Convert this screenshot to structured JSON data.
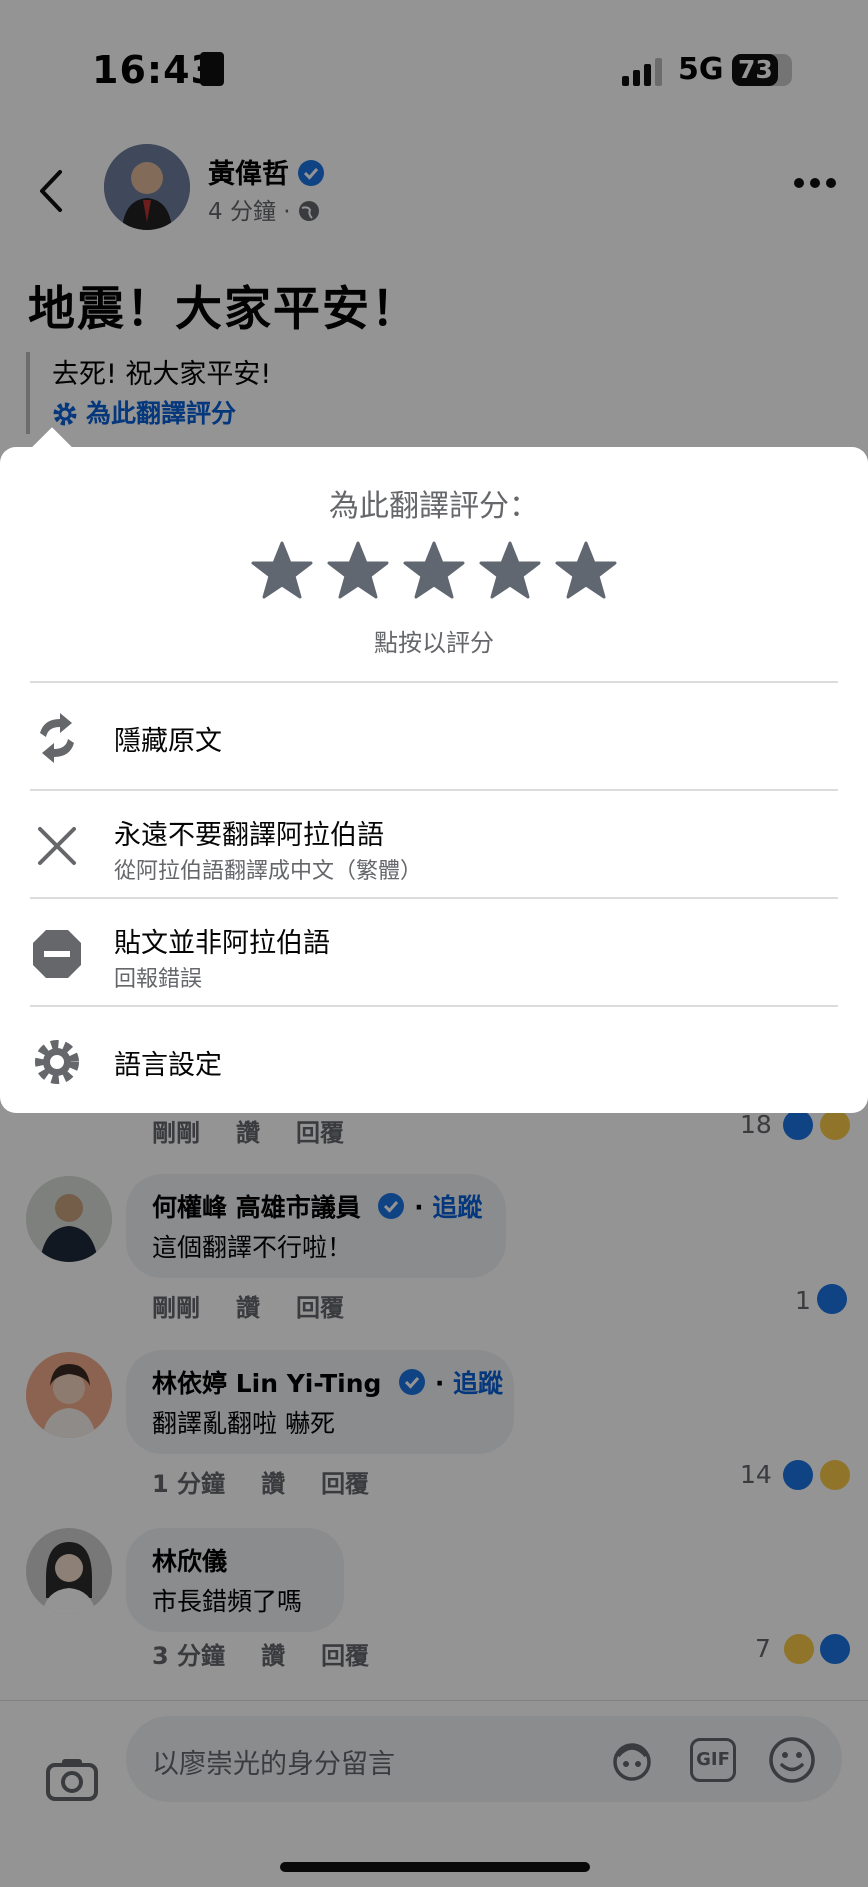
{
  "status_bar": {
    "time": "16:43",
    "network": "5G",
    "battery": "73"
  },
  "post": {
    "author": "黃偉哲",
    "time": "4 分鐘",
    "title": "地震！大家平安！",
    "translation": "去死! 祝大家平安!",
    "rate_link": "為此翻譯評分"
  },
  "sheet": {
    "title": "為此翻譯評分：",
    "tap_hint": "點按以評分",
    "items": [
      {
        "label": "隱藏原文",
        "sub": ""
      },
      {
        "label": "永遠不要翻譯阿拉伯語",
        "sub": "從阿拉伯語翻譯成中文（繁體）"
      },
      {
        "label": "貼文並非阿拉伯語",
        "sub": "回報錯誤"
      },
      {
        "label": "語言設定",
        "sub": ""
      }
    ]
  },
  "comments": [
    {
      "name": "",
      "text": "",
      "time": "剛剛",
      "like": "讚",
      "reply": "回覆",
      "count": "18"
    },
    {
      "name": "何權峰 高雄市議員",
      "follow": "追蹤",
      "text": "這個翻譯不行啦！",
      "time": "剛剛",
      "like": "讚",
      "reply": "回覆",
      "count": "1"
    },
    {
      "name": "林依婷 Lin Yi-Ting",
      "follow": "追蹤",
      "text": "翻譯亂翻啦 嚇死",
      "time": "1 分鐘",
      "like": "讚",
      "reply": "回覆",
      "count": "14"
    },
    {
      "name": "林欣儀",
      "text": "市長錯頻了嗎",
      "time": "3 分鐘",
      "like": "讚",
      "reply": "回覆",
      "count": "7"
    }
  ],
  "composer": {
    "placeholder": "以廖崇光的身分留言",
    "gif": "GIF"
  },
  "colors": {
    "accent": "#0a5fd6",
    "like": "#1b74e4",
    "star": "#606770"
  }
}
